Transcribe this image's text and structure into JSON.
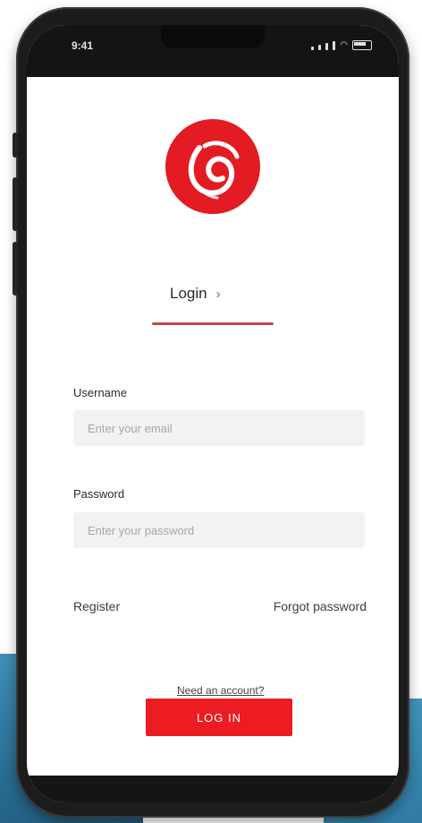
{
  "status_bar": {
    "time": "9:41"
  },
  "app": {
    "logo_icon": "brand-logo-icon",
    "brand_color": "#e31b23"
  },
  "tabs": {
    "active_label": "Login",
    "arrow_glyph": "›"
  },
  "form": {
    "email_label": "Username",
    "email_placeholder": "Enter your email",
    "password_label": "Password",
    "password_placeholder": "Enter your password"
  },
  "links": {
    "left": "Register",
    "right": "Forgot password",
    "small_link": "Need an account?"
  },
  "buttons": {
    "login_label": "LOG IN"
  },
  "colors": {
    "accent": "#ec1c22",
    "tab_underline": "#c64a4f",
    "field_bg": "#f2f2f2"
  }
}
